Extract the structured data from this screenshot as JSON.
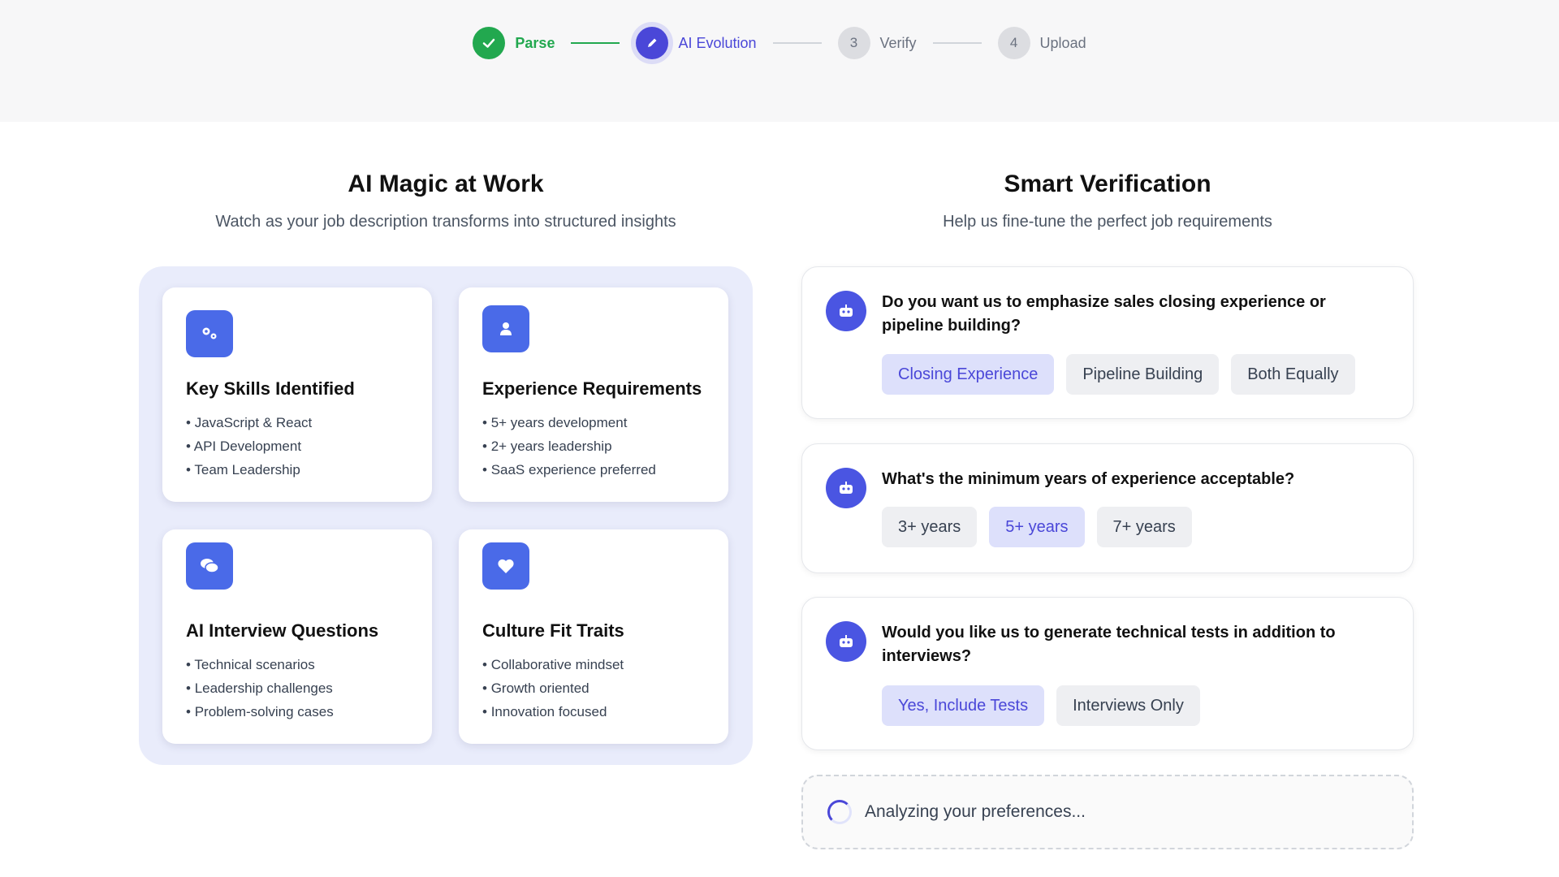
{
  "stepper": {
    "steps": [
      {
        "number": "",
        "label": "Parse",
        "state": "done"
      },
      {
        "number": "",
        "label": "AI Evolution",
        "state": "active"
      },
      {
        "number": "3",
        "label": "Verify",
        "state": "pending"
      },
      {
        "number": "4",
        "label": "Upload",
        "state": "pending"
      }
    ]
  },
  "left": {
    "title": "AI Magic at Work",
    "subtitle": "Watch as your job description transforms into structured insights",
    "cards": [
      {
        "title": "Key Skills Identified",
        "icon": "gears-icon",
        "items": [
          "JavaScript & React",
          "API Development",
          "Team Leadership"
        ]
      },
      {
        "title": "Experience Requirements",
        "icon": "person-icon",
        "items": [
          "5+ years development",
          "2+ years leadership",
          "SaaS experience preferred"
        ]
      },
      {
        "title": "AI Interview Questions",
        "icon": "chat-bubbles-icon",
        "items": [
          "Technical scenarios",
          "Leadership challenges",
          "Problem-solving cases"
        ]
      },
      {
        "title": "Culture Fit Traits",
        "icon": "heart-icon",
        "items": [
          "Collaborative mindset",
          "Growth oriented",
          "Innovation focused"
        ]
      }
    ]
  },
  "right": {
    "title": "Smart Verification",
    "subtitle": "Help us fine-tune the perfect job requirements",
    "questions": [
      {
        "text": "Do you want us to emphasize sales closing experience or pipeline building?",
        "options": [
          "Closing Experience",
          "Pipeline Building",
          "Both Equally"
        ],
        "selected": "Closing Experience"
      },
      {
        "text": "What's the minimum years of experience acceptable?",
        "options": [
          "3+ years",
          "5+ years",
          "7+ years"
        ],
        "selected": "5+ years"
      },
      {
        "text": "Would you like us to generate technical tests in addition to interviews?",
        "options": [
          "Yes, Include Tests",
          "Interviews Only"
        ],
        "selected": "Yes, Include Tests"
      }
    ],
    "status": "Analyzing your preferences..."
  },
  "colors": {
    "accent": "#4a47d8",
    "success": "#22a84f",
    "icon_bg": "#4a6ae8",
    "panel_bg": "#e9ecfb"
  }
}
